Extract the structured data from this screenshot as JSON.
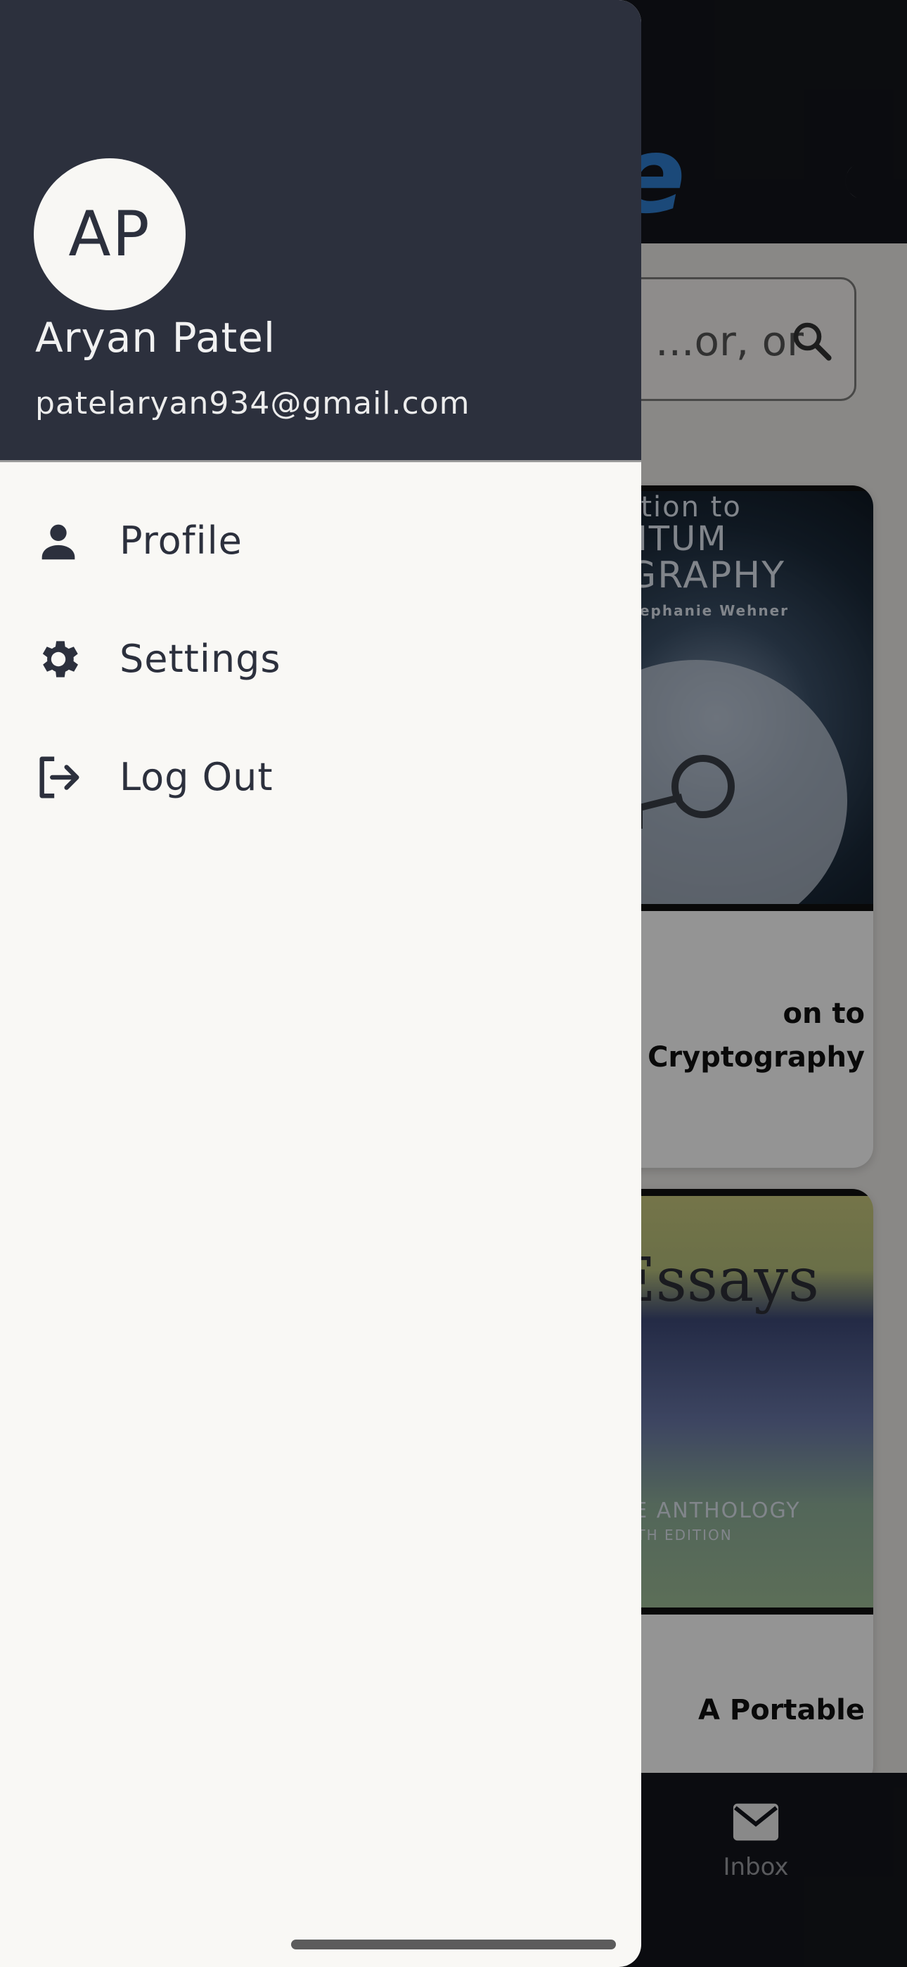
{
  "background_app": {
    "brand_fragment": "se",
    "search_placeholder_fragment": "or, or...",
    "cards": [
      {
        "cover_lines": [
          "uction to",
          "ANTUM",
          "OGRAPHY",
          "Stephanie Wehner"
        ],
        "title": "on to\nCryptography"
      },
      {
        "cover_lines": [
          "Essays",
          "BLE ANTHOLOGY",
          "XTH EDITION"
        ],
        "title": "A Portable"
      }
    ],
    "bottom_nav": {
      "inbox_label": "Inbox"
    }
  },
  "drawer": {
    "avatar_initials": "AP",
    "user_name": "Aryan Patel",
    "user_email": "patelaryan934@gmail.com",
    "menu": [
      {
        "label": "Profile",
        "icon": "person-icon"
      },
      {
        "label": "Settings",
        "icon": "gear-icon"
      },
      {
        "label": "Log Out",
        "icon": "logout-icon"
      }
    ]
  },
  "colors": {
    "drawer_header": "#2c303d",
    "drawer_body": "#f9f8f5",
    "brand_blue": "#2f7fd0"
  }
}
